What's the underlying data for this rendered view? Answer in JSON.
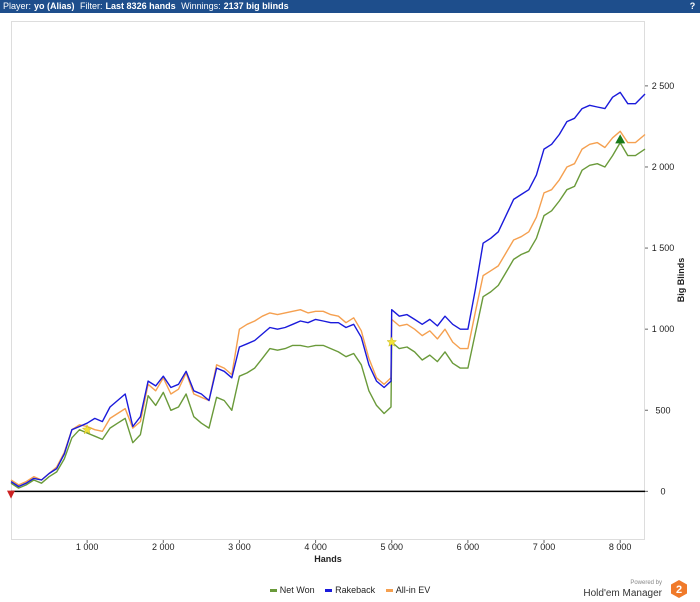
{
  "header": {
    "player_label": "Player:",
    "player_value": "yo (Alias)",
    "filter_label": "Filter:",
    "filter_value": "Last 8326 hands",
    "winnings_label": "Winnings:",
    "winnings_value": "2137 big blinds",
    "help_label": "?"
  },
  "brand": {
    "powered_by": "Powered by",
    "name": "Hold'em Manager",
    "logo_number": "2",
    "logo_color": "#f07a2a"
  },
  "colors": {
    "net_won": "#6a9a3a",
    "rakeback": "#1a1adb",
    "all_in_ev": "#f5a050",
    "titlebar": "#1e4e8c",
    "zero_line": "#000000"
  },
  "chart_data": {
    "type": "line",
    "title": "",
    "xlabel": "Hands",
    "ylabel": "Big Blinds",
    "xlim": [
      0,
      8326
    ],
    "ylim": [
      -300,
      2900
    ],
    "x_ticks": [
      1000,
      2000,
      3000,
      4000,
      5000,
      6000,
      7000,
      8000
    ],
    "x_tick_labels": [
      "1 000",
      "2 000",
      "3 000",
      "4 000",
      "5 000",
      "6 000",
      "7 000",
      "8 000"
    ],
    "y_ticks": [
      0,
      500,
      1000,
      1500,
      2000,
      2500
    ],
    "y_tick_labels": [
      "0",
      "500",
      "1 000",
      "1 500",
      "2 000",
      "2 500"
    ],
    "legend_position": "bottom",
    "grid": false,
    "series": [
      {
        "name": "Net Won",
        "color": "#6a9a3a",
        "x": [
          0,
          100,
          200,
          300,
          400,
          500,
          600,
          700,
          800,
          900,
          1000,
          1100,
          1200,
          1300,
          1400,
          1500,
          1600,
          1700,
          1800,
          1900,
          2000,
          2100,
          2200,
          2300,
          2400,
          2500,
          2600,
          2700,
          2800,
          2900,
          3000,
          3100,
          3200,
          3300,
          3400,
          3500,
          3600,
          3700,
          3800,
          3900,
          4000,
          4100,
          4200,
          4300,
          4400,
          4500,
          4600,
          4700,
          4800,
          4900,
          4990,
          5000,
          5100,
          5200,
          5300,
          5400,
          5500,
          5600,
          5700,
          5800,
          5900,
          6000,
          6100,
          6200,
          6300,
          6400,
          6500,
          6600,
          6700,
          6800,
          6900,
          7000,
          7100,
          7200,
          7300,
          7400,
          7500,
          7600,
          7700,
          7800,
          7900,
          8000,
          8100,
          8200,
          8326
        ],
        "y": [
          50,
          20,
          40,
          70,
          50,
          90,
          120,
          200,
          330,
          380,
          360,
          340,
          320,
          390,
          420,
          450,
          300,
          350,
          590,
          530,
          610,
          500,
          520,
          600,
          460,
          420,
          390,
          580,
          560,
          500,
          710,
          730,
          760,
          820,
          880,
          870,
          880,
          900,
          900,
          890,
          900,
          900,
          880,
          860,
          830,
          850,
          780,
          620,
          530,
          480,
          520,
          920,
          880,
          890,
          860,
          810,
          840,
          800,
          860,
          790,
          760,
          760,
          980,
          1200,
          1230,
          1270,
          1350,
          1430,
          1460,
          1480,
          1560,
          1700,
          1730,
          1790,
          1860,
          1880,
          1980,
          2010,
          2020,
          2000,
          2070,
          2150,
          2070,
          2070,
          2110
        ]
      },
      {
        "name": "Rakeback",
        "color": "#1a1adb",
        "x": [
          0,
          100,
          200,
          300,
          400,
          500,
          600,
          700,
          800,
          900,
          1000,
          1100,
          1200,
          1300,
          1400,
          1500,
          1600,
          1700,
          1800,
          1900,
          2000,
          2100,
          2200,
          2300,
          2400,
          2500,
          2600,
          2700,
          2800,
          2900,
          3000,
          3100,
          3200,
          3300,
          3400,
          3500,
          3600,
          3700,
          3800,
          3900,
          4000,
          4100,
          4200,
          4300,
          4400,
          4500,
          4600,
          4700,
          4800,
          4900,
          4990,
          5000,
          5100,
          5200,
          5300,
          5400,
          5500,
          5600,
          5700,
          5800,
          5900,
          6000,
          6100,
          6200,
          6300,
          6400,
          6500,
          6600,
          6700,
          6800,
          6900,
          7000,
          7100,
          7200,
          7300,
          7400,
          7500,
          7600,
          7700,
          7800,
          7900,
          8000,
          8100,
          8200,
          8326
        ],
        "y": [
          60,
          30,
          50,
          80,
          70,
          110,
          140,
          230,
          380,
          400,
          420,
          450,
          430,
          520,
          560,
          600,
          400,
          460,
          680,
          650,
          710,
          640,
          660,
          740,
          620,
          600,
          560,
          760,
          740,
          700,
          890,
          910,
          930,
          970,
          1010,
          1000,
          1010,
          1030,
          1050,
          1040,
          1060,
          1050,
          1040,
          1040,
          1010,
          1030,
          950,
          780,
          680,
          640,
          680,
          1120,
          1080,
          1090,
          1060,
          1030,
          1060,
          1020,
          1080,
          1030,
          1000,
          1000,
          1250,
          1530,
          1560,
          1600,
          1700,
          1800,
          1830,
          1860,
          1950,
          2110,
          2140,
          2200,
          2280,
          2300,
          2360,
          2380,
          2370,
          2360,
          2430,
          2460,
          2390,
          2390,
          2450
        ]
      },
      {
        "name": "All-in EV",
        "color": "#f5a050",
        "x": [
          0,
          100,
          200,
          300,
          400,
          500,
          600,
          700,
          800,
          900,
          1000,
          1100,
          1200,
          1300,
          1400,
          1500,
          1600,
          1700,
          1800,
          1900,
          2000,
          2100,
          2200,
          2300,
          2400,
          2500,
          2600,
          2700,
          2800,
          2900,
          3000,
          3100,
          3200,
          3300,
          3400,
          3500,
          3600,
          3700,
          3800,
          3900,
          4000,
          4100,
          4200,
          4300,
          4400,
          4500,
          4600,
          4700,
          4800,
          4900,
          4990,
          5000,
          5100,
          5200,
          5300,
          5400,
          5500,
          5600,
          5700,
          5800,
          5900,
          6000,
          6100,
          6200,
          6300,
          6400,
          6500,
          6600,
          6700,
          6800,
          6900,
          7000,
          7100,
          7200,
          7300,
          7400,
          7500,
          7600,
          7700,
          7800,
          7900,
          8000,
          8100,
          8200,
          8326
        ],
        "y": [
          70,
          40,
          60,
          90,
          70,
          110,
          150,
          240,
          380,
          410,
          400,
          380,
          370,
          450,
          480,
          510,
          390,
          430,
          660,
          620,
          700,
          600,
          630,
          730,
          600,
          580,
          560,
          780,
          760,
          720,
          1000,
          1030,
          1050,
          1080,
          1100,
          1090,
          1100,
          1110,
          1120,
          1100,
          1110,
          1110,
          1090,
          1080,
          1040,
          1070,
          990,
          820,
          700,
          660,
          700,
          1060,
          1020,
          1030,
          1000,
          960,
          990,
          940,
          1000,
          920,
          880,
          880,
          1110,
          1330,
          1360,
          1390,
          1470,
          1550,
          1570,
          1600,
          1690,
          1840,
          1860,
          1920,
          2000,
          2020,
          2110,
          2140,
          2150,
          2120,
          2180,
          2220,
          2150,
          2150,
          2200
        ]
      }
    ],
    "markers": [
      {
        "kind": "triangle-down",
        "color": "#cc2222",
        "x": 0,
        "y": -20
      },
      {
        "kind": "star",
        "color": "#f2e23a",
        "x": 1000,
        "y": 380
      },
      {
        "kind": "star",
        "color": "#f2e23a",
        "x": 5000,
        "y": 920
      },
      {
        "kind": "triangle-up",
        "color": "#1a7a1a",
        "x": 8000,
        "y": 2170
      }
    ]
  }
}
